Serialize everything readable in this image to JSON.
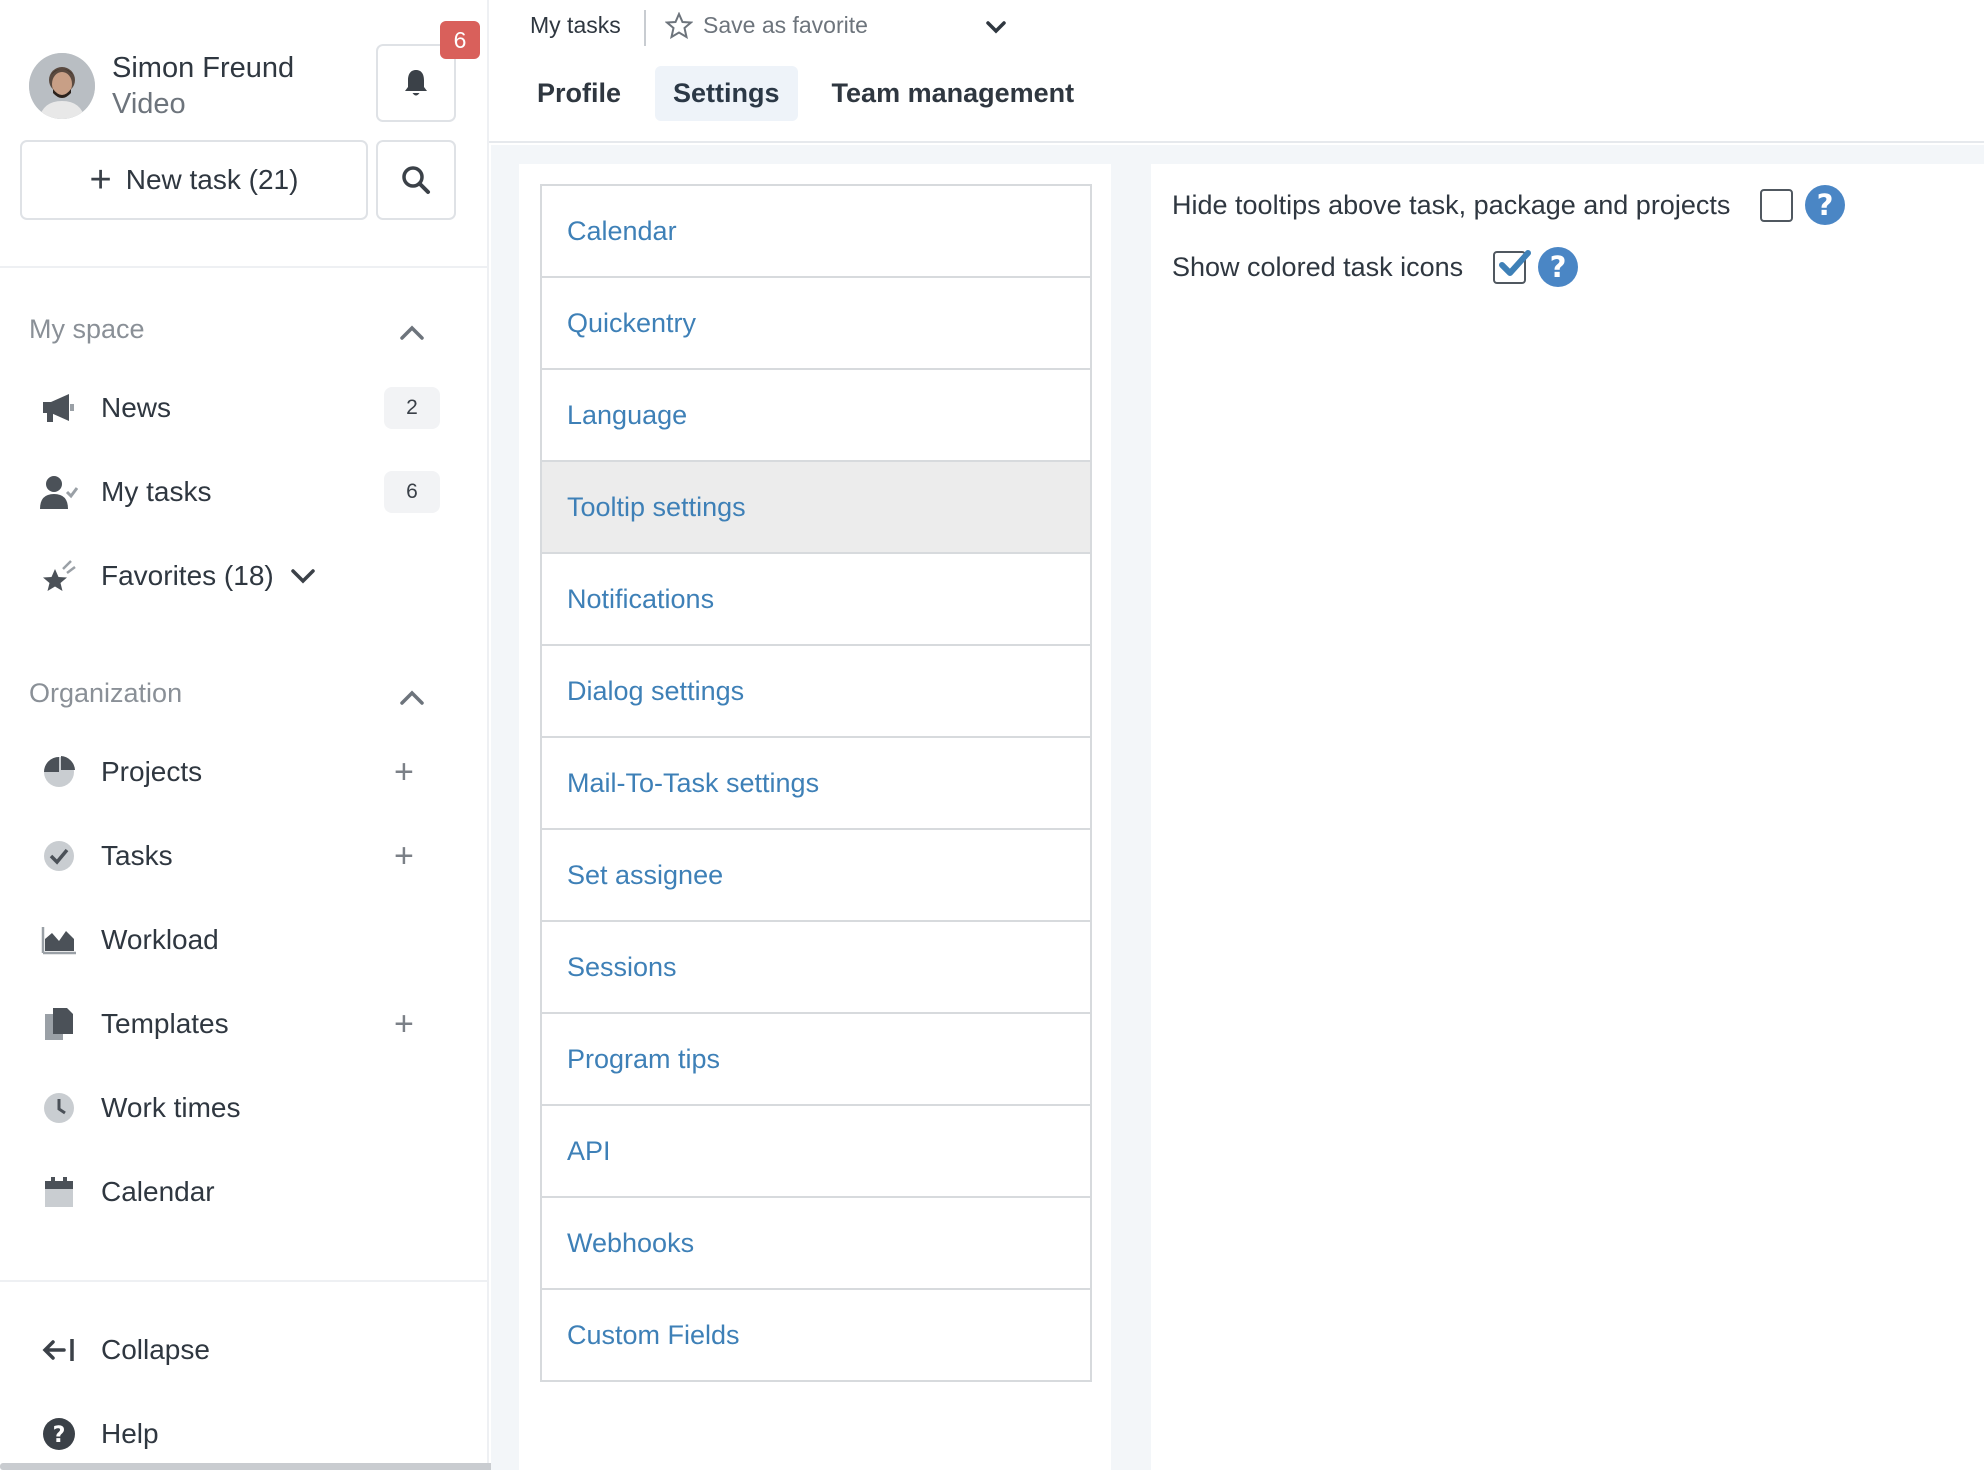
{
  "user": {
    "name": "Simon Freund",
    "subtitle": "Video"
  },
  "notifications": {
    "count": "6"
  },
  "toolbar": {
    "new_task_label": "New task (21)"
  },
  "sidebar": {
    "my_space": {
      "title": "My space",
      "items": [
        {
          "label": "News",
          "count": "2",
          "icon": "megaphone-icon"
        },
        {
          "label": "My tasks",
          "count": "6",
          "icon": "user-check-icon"
        },
        {
          "label": "Favorites (18)",
          "icon": "star-icon"
        }
      ]
    },
    "organization": {
      "title": "Organization",
      "items": [
        {
          "label": "Projects",
          "icon": "pie-chart-icon",
          "addable": true
        },
        {
          "label": "Tasks",
          "icon": "check-circle-icon",
          "addable": true
        },
        {
          "label": "Workload",
          "icon": "area-chart-icon"
        },
        {
          "label": "Templates",
          "icon": "documents-icon",
          "addable": true
        },
        {
          "label": "Work times",
          "icon": "clock-icon"
        },
        {
          "label": "Calendar",
          "icon": "calendar-icon"
        }
      ]
    },
    "footer": {
      "collapse_label": "Collapse",
      "help_label": "Help"
    }
  },
  "header": {
    "breadcrumb": "My tasks",
    "favorite_label": "Save as favorite",
    "tabs": [
      {
        "label": "Profile",
        "active": false
      },
      {
        "label": "Settings",
        "active": true
      },
      {
        "label": "Team management",
        "active": false
      }
    ]
  },
  "settings_menu": {
    "items": [
      "Calendar",
      "Quickentry",
      "Language",
      "Tooltip settings",
      "Notifications",
      "Dialog settings",
      "Mail-To-Task settings",
      "Set assignee",
      "Sessions",
      "Program tips",
      "API",
      "Webhooks",
      "Custom Fields"
    ],
    "selected": "Tooltip settings"
  },
  "tooltip_settings": {
    "hide_tooltips": {
      "label": "Hide tooltips above task, package and projects",
      "checked": false
    },
    "colored_icons": {
      "label": "Show colored task icons",
      "checked": true
    }
  },
  "colors": {
    "link_blue": "#3e80b7",
    "help_blue": "#4a86c5",
    "badge_red": "#d9605b",
    "checkbox_check": "#3e80b7"
  }
}
